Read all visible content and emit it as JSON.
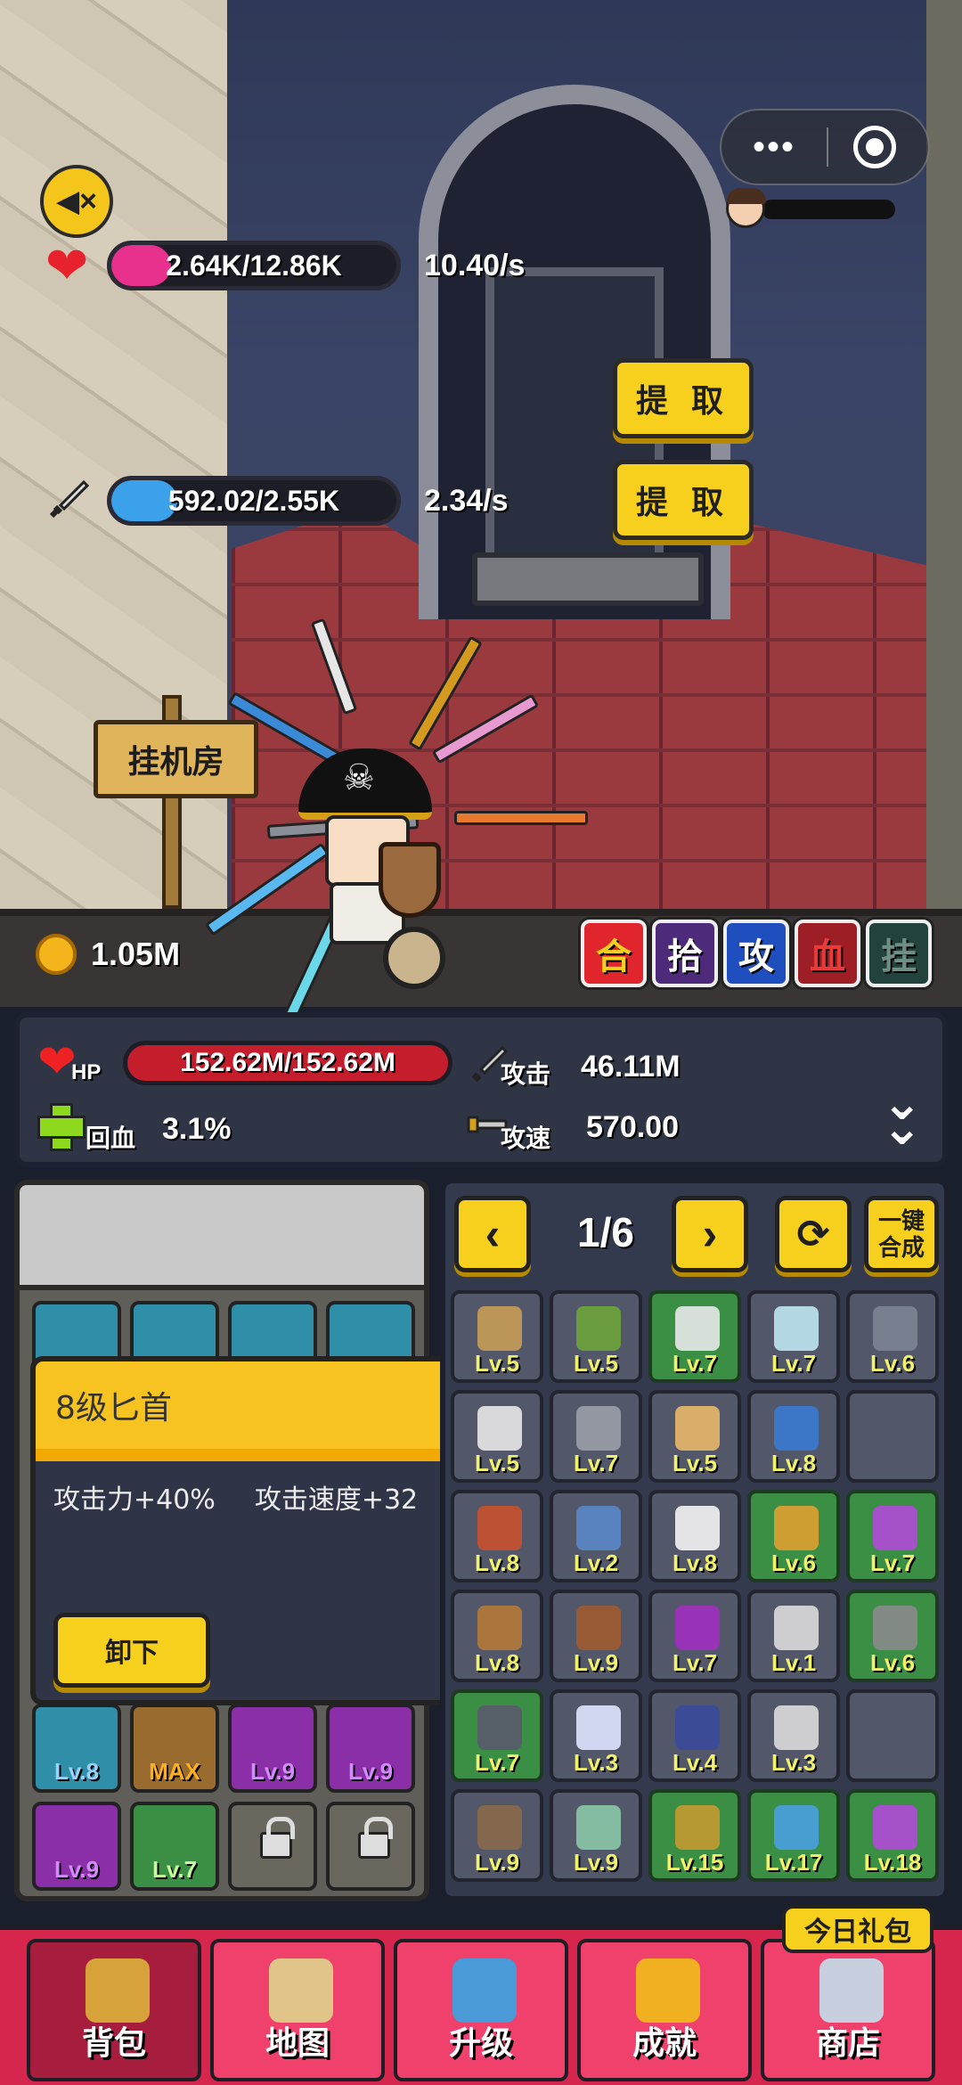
{
  "top_bar": {
    "more_label": "•••"
  },
  "player": {
    "hp_bar": {
      "text": "2.64K/12.86K",
      "rate": "10.40/s",
      "fill_fraction": 0.21,
      "color": "#e8318c"
    },
    "atk_bar": {
      "text": "592.02/2.55K",
      "rate": "2.34/s",
      "fill_fraction": 0.23,
      "color": "#3aa1ea"
    },
    "extract_label": "提 取"
  },
  "scene": {
    "sign": "挂机房",
    "coins": "1.05M"
  },
  "quick_buttons": [
    {
      "label": "合",
      "color": "#e0262c",
      "text_color": "#f7cf1d"
    },
    {
      "label": "拾",
      "color": "#4e2a7a",
      "text_color": "#ffffff"
    },
    {
      "label": "攻",
      "color": "#1f4fbf",
      "text_color": "#ffffff"
    },
    {
      "label": "血",
      "color": "#9d1e24",
      "text_color": "#e93a3a"
    },
    {
      "label": "挂",
      "color": "#22433d",
      "text_color": "#6f8f86"
    }
  ],
  "stats": {
    "hp_label": "HP",
    "hp_value": "152.62M/152.62M",
    "regen_label": "回血",
    "regen_value": "3.1%",
    "atk_label": "攻击",
    "atk_value": "46.11M",
    "speed_label": "攻速",
    "speed_value": "570.00"
  },
  "equipped_slots": [
    {
      "label": "Lv.8",
      "color": "#2f8fa8",
      "text_color": "#9ad2ff"
    },
    {
      "label": "MAX",
      "color": "#9a6b2e",
      "text_color": "#ffb020"
    },
    {
      "label": "Lv.9",
      "color": "#8a2fa8",
      "text_color": "#d28bff"
    },
    {
      "label": "Lv.9",
      "color": "#8a2fa8",
      "text_color": "#d28bff"
    },
    {
      "label": "Lv.9",
      "color": "#8a2fa8",
      "text_color": "#d28bff"
    },
    {
      "label": "Lv.7",
      "color": "#3b8f45",
      "text_color": "#c8ff9a"
    }
  ],
  "popup": {
    "title": "8级匕首",
    "effect_1": "攻击力+40%",
    "effect_2": "攻击速度+32",
    "unequip_label": "卸下"
  },
  "bag": {
    "page": "1/6",
    "merge_all_label": "一键合成",
    "prev_icon": "chevron-left-icon",
    "next_icon": "chevron-right-icon",
    "refresh_icon": "refresh-icon",
    "items": [
      {
        "level": "Lv.5",
        "green": false,
        "color": "#c89c58"
      },
      {
        "level": "Lv.5",
        "green": false,
        "color": "#6ca53a"
      },
      {
        "level": "Lv.7",
        "green": true,
        "color": "#e8e8e8"
      },
      {
        "level": "Lv.7",
        "green": false,
        "color": "#bfe6f2"
      },
      {
        "level": "Lv.6",
        "green": false,
        "color": "#7c8494"
      },
      {
        "level": "Lv.5",
        "green": false,
        "color": "#e8e8e8"
      },
      {
        "level": "Lv.7",
        "green": false,
        "color": "#9aa0aa"
      },
      {
        "level": "Lv.5",
        "green": false,
        "color": "#e8b86a"
      },
      {
        "level": "Lv.8",
        "green": false,
        "color": "#3a7ad0"
      },
      {
        "level": "",
        "green": false,
        "color": ""
      },
      {
        "level": "Lv.8",
        "green": false,
        "color": "#c8522e"
      },
      {
        "level": "Lv.2",
        "green": false,
        "color": "#5a88c8"
      },
      {
        "level": "Lv.8",
        "green": false,
        "color": "#f4f4f4"
      },
      {
        "level": "Lv.6",
        "green": true,
        "color": "#e0a030"
      },
      {
        "level": "Lv.7",
        "green": true,
        "color": "#b04ad8"
      },
      {
        "level": "Lv.8",
        "green": false,
        "color": "#b57a3a"
      },
      {
        "level": "Lv.9",
        "green": false,
        "color": "#a05a30"
      },
      {
        "level": "Lv.7",
        "green": false,
        "color": "#a030c0"
      },
      {
        "level": "Lv.1",
        "green": false,
        "color": "#dcdcdc"
      },
      {
        "level": "Lv.6",
        "green": true,
        "color": "#8a8a8a"
      },
      {
        "level": "Lv.7",
        "green": true,
        "color": "#5a5a6a"
      },
      {
        "level": "Lv.3",
        "green": false,
        "color": "#dfe6ff"
      },
      {
        "level": "Lv.4",
        "green": false,
        "color": "#3a4a9a"
      },
      {
        "level": "Lv.3",
        "green": false,
        "color": "#dcdcdc"
      },
      {
        "level": "",
        "green": false,
        "color": ""
      },
      {
        "level": "Lv.9",
        "green": false,
        "color": "#8a6a4a"
      },
      {
        "level": "Lv.9",
        "green": false,
        "color": "#8ac8a8"
      },
      {
        "level": "Lv.15",
        "green": true,
        "color": "#c49a30"
      },
      {
        "level": "Lv.17",
        "green": true,
        "color": "#4aa0e0"
      },
      {
        "level": "Lv.18",
        "green": true,
        "color": "#b04ad8"
      }
    ]
  },
  "tabs": [
    {
      "label": "背包",
      "icon": "bag-icon",
      "active": true,
      "color": "#d8a23a"
    },
    {
      "label": "地图",
      "icon": "map-icon",
      "active": false,
      "color": "#e0c488"
    },
    {
      "label": "升级",
      "icon": "robot-icon",
      "active": false,
      "color": "#4a9ad8"
    },
    {
      "label": "成就",
      "icon": "trophy-icon",
      "active": false,
      "color": "#f0b020"
    },
    {
      "label": "商店",
      "icon": "shop-icon",
      "active": false,
      "color": "#c8d0e0"
    }
  ],
  "gift_tag": "今日礼包"
}
